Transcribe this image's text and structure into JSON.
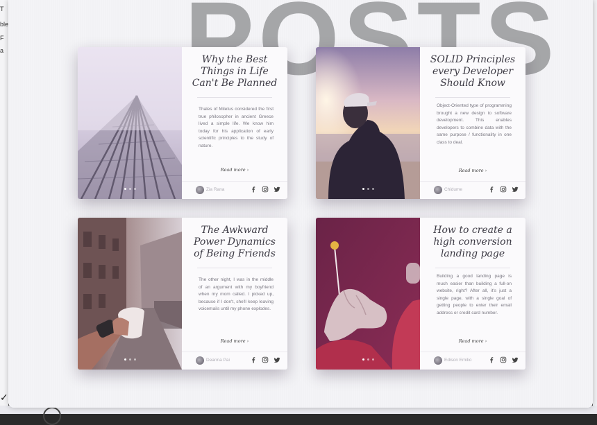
{
  "page": {
    "heading": "POSTS",
    "background_fragments": [
      "T",
      "ble",
      "F",
      "a"
    ]
  },
  "colors": {
    "panel_bg": "#f3f3f6",
    "title_watermark": "#a5a6a8",
    "card_bg": "#fbfafc",
    "title_text": "#3c3a44",
    "body_text": "#7a7882"
  },
  "cards": [
    {
      "title": "Why the Best Things in Life Can't Be Planned",
      "excerpt": "Thales of Miletus considered the first true philosopher in ancient Greece lived a simple life. We know him today for his application of early scientific principles to the study of nature.",
      "read_more": "Read more ›",
      "author": "Zia Rana",
      "image": "skyscraper-fog",
      "slides": 3,
      "active_slide": 1,
      "social_icons": [
        "facebook-icon",
        "instagram-icon",
        "twitter-icon"
      ]
    },
    {
      "title": "SOLID Principles every Developer Should Know",
      "excerpt": "Object-Oriented type of programming brought a new design to software development. This enables developers to combine data with the same purpose / functionality in one class to deal.",
      "read_more": "Read more ›",
      "author": "Chidume",
      "image": "person-sunset-beach",
      "slides": 3,
      "active_slide": 1,
      "social_icons": [
        "facebook-icon",
        "instagram-icon",
        "twitter-icon"
      ]
    },
    {
      "title": "The Awkward Power Dynamics of Being Friends",
      "excerpt": "The other night, I was in the middle of an argument with my boyfriend when my mom called. I picked up, because if I don't, she'll keep leaving voicemails until my phone explodes.",
      "read_more": "Read more ›",
      "author": "Deanna Pai",
      "image": "coffee-cup-street",
      "slides": 3,
      "active_slide": 1,
      "social_icons": [
        "facebook-icon",
        "instagram-icon",
        "twitter-icon"
      ]
    },
    {
      "title": "How to create a high conversion landing page",
      "excerpt": "Building a good landing page is much easier than building a full-on website, right? After all, it's just a single page, with a single goal of getting people to enter their email address or credit card number.",
      "read_more": "Read more ›",
      "author": "Edison Emilio",
      "image": "hand-lollipop",
      "slides": 3,
      "active_slide": 1,
      "social_icons": [
        "facebook-icon",
        "instagram-icon",
        "twitter-icon"
      ]
    }
  ]
}
